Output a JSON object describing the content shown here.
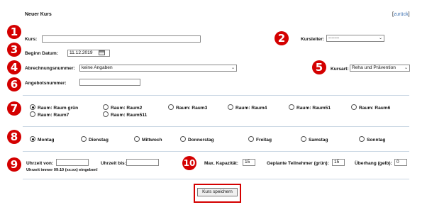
{
  "header": {
    "title": "Neuer Kurs",
    "back_prefix": "[",
    "back_link": "zurück",
    "back_suffix": "]"
  },
  "badges": [
    "1",
    "2",
    "3",
    "4",
    "5",
    "6",
    "7",
    "8",
    "9",
    "10"
  ],
  "fields": {
    "kurs_label": "Kurs:",
    "kurs_value": "",
    "kursleiter_label": "Kursleiter:",
    "kursleiter_value": "-------",
    "beginn_label": "Beginn Datum:",
    "beginn_value": "11.12.2019",
    "abrechnung_label": "Abrechnungsnummer:",
    "abrechnung_value": "keine Angaben",
    "kursart_label": "Kursart:",
    "kursart_value": "Reha und Prävention",
    "angebot_label": "Angebotsnummer:",
    "angebot_value": ""
  },
  "rooms": [
    {
      "label": "Raum:  Raum grün",
      "checked": true
    },
    {
      "label": "Raum:  Raum2",
      "checked": false
    },
    {
      "label": "Raum:  Raum3",
      "checked": false
    },
    {
      "label": "Raum:  Raum4",
      "checked": false
    },
    {
      "label": "Raum:  Raum51",
      "checked": false
    },
    {
      "label": "Raum:  Raum6",
      "checked": false
    },
    {
      "label": "Raum:  Raum7",
      "checked": false
    },
    {
      "label": "Raum:  Raum511",
      "checked": false
    }
  ],
  "days": [
    {
      "label": "Montag",
      "checked": true
    },
    {
      "label": "Dienstag",
      "checked": false
    },
    {
      "label": "Mittwoch",
      "checked": false
    },
    {
      "label": "Donnerstag",
      "checked": false
    },
    {
      "label": "Freitag",
      "checked": false
    },
    {
      "label": "Samstag",
      "checked": false
    },
    {
      "label": "Sonntag",
      "checked": false
    }
  ],
  "time": {
    "von_label": "Uhrzeit von:",
    "von_value": "",
    "bis_label": "Uhrzeit bis:",
    "bis_value": "",
    "hint": "Uhrzeit immer 09:10 (xx:xx) eingeben!"
  },
  "capacity": {
    "max_label": "Max. Kapazität:",
    "max_value": "15",
    "geplant_label": "Geplante Teilnehmer (grün):",
    "geplant_value": "15",
    "ueberhang_label": "Überhang (gelb):",
    "ueberhang_value": "0"
  },
  "save_button": "Kurs speichern",
  "colors": {
    "badge": "#d40000",
    "divider": "#c9d6e3",
    "link": "#3a6fb0"
  },
  "icons": {
    "calendar": "calendar-icon",
    "dropdown": "chevron-down-icon"
  }
}
